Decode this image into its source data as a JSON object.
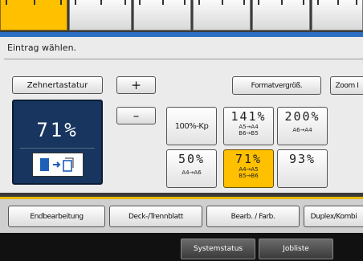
{
  "top_tabs": [
    {
      "state": "active"
    },
    {
      "state": "normal"
    },
    {
      "state": "normal"
    },
    {
      "state": "normal"
    },
    {
      "state": "normal"
    },
    {
      "state": "normal"
    }
  ],
  "prompt": "Eintrag wählen.",
  "row1": {
    "keypad_button": "Zehnertastatur",
    "plus_button": "+",
    "minus_button": "–",
    "format_size_button": "Formatvergröß.",
    "zoom_button": "Zoom I"
  },
  "current_zoom": {
    "value": "71%",
    "icon": "original-to-copy-reduce-icon"
  },
  "presets": {
    "fullsize": "100%-Kp",
    "p141": {
      "pct": "141%",
      "line1": "A5→A4",
      "line2": "B6→B5"
    },
    "p200": {
      "pct": "200%",
      "line1": "A6→A4",
      "line2": ""
    },
    "p50": {
      "pct": "50%",
      "line1": "A4→A6",
      "line2": ""
    },
    "p71": {
      "pct": "71%",
      "line1": "A4→A5",
      "line2": "B5→B6"
    },
    "p93": {
      "pct": "93%",
      "line1": "",
      "line2": ""
    }
  },
  "function_tabs": {
    "finishing": "Endbearbeitung",
    "cover": "Deck-/Trennblatt",
    "edit_color": "Bearb. / Farb.",
    "duplex": "Duplex/Kombi"
  },
  "status_buttons": {
    "system_status": "Systemstatus",
    "job_list": "Jobliste"
  },
  "colors": {
    "accent_yellow": "#ffc000",
    "zoom_box": "#17355e",
    "blue_band": "#2c6fc4"
  }
}
